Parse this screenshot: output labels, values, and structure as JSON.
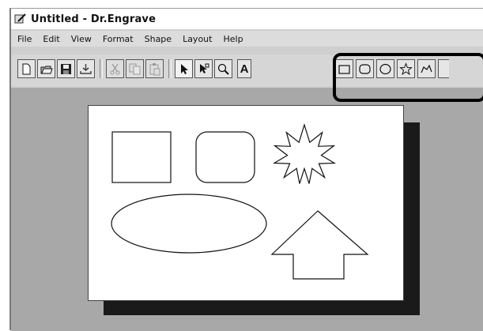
{
  "window": {
    "title": "Untitled - Dr.Engrave"
  },
  "menu": [
    "File",
    "Edit",
    "View",
    "Format",
    "Shape",
    "Layout",
    "Help"
  ],
  "toolbar": {
    "buttons": [
      {
        "name": "new-file-button",
        "icon": "new-file-icon"
      },
      {
        "name": "open-button",
        "icon": "open-folder-icon"
      },
      {
        "name": "save-button",
        "icon": "save-icon"
      },
      {
        "name": "import-button",
        "icon": "import-icon"
      },
      {
        "name": "cut-button",
        "icon": "cut-icon"
      },
      {
        "name": "copy-button",
        "icon": "copy-icon"
      },
      {
        "name": "paste-button",
        "icon": "paste-icon"
      },
      {
        "name": "select-tool-button",
        "icon": "arrow-pointer-icon"
      },
      {
        "name": "node-edit-tool-button",
        "icon": "node-edit-icon"
      },
      {
        "name": "zoom-tool-button",
        "icon": "magnifier-icon"
      },
      {
        "name": "text-tool-button",
        "icon": "text-tool-icon",
        "label": "A"
      },
      {
        "name": "rectangle-tool-button",
        "icon": "rectangle-icon"
      },
      {
        "name": "rounded-rectangle-tool-button",
        "icon": "rounded-rectangle-icon"
      },
      {
        "name": "ellipse-tool-button",
        "icon": "ellipse-icon"
      },
      {
        "name": "star-tool-button",
        "icon": "star-icon"
      },
      {
        "name": "polyline-tool-button",
        "icon": "polyline-icon"
      }
    ]
  },
  "canvas": {
    "shapes": [
      "rectangle",
      "rounded-rectangle",
      "starburst",
      "ellipse",
      "up-arrow"
    ]
  },
  "colors": {
    "workspace": "#a8a8a8",
    "paper": "#ffffff",
    "shadow": "#1a1a1a",
    "highlight": "#000000"
  }
}
